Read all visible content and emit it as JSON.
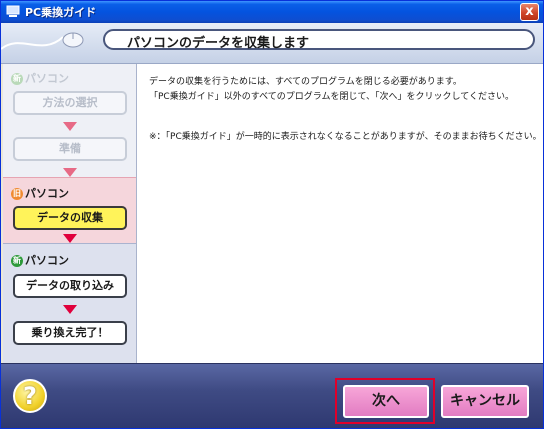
{
  "window": {
    "title": "PC乗換ガイド",
    "close_label": "x"
  },
  "header": {
    "title": "パソコンのデータを収集します"
  },
  "sidebar": {
    "pc_section": {
      "label": "パソコン",
      "badge": "新"
    },
    "old_section": {
      "label": "パソコン",
      "badge": "旧"
    },
    "new_section": {
      "label": "パソコン",
      "badge": "新"
    },
    "steps": [
      {
        "label": "方法の選択",
        "state": "disabled"
      },
      {
        "label": "準備",
        "state": "disabled"
      },
      {
        "label": "データの収集",
        "state": "active"
      },
      {
        "label": "データの取り込み",
        "state": "normal"
      },
      {
        "label": "乗り換え完了！",
        "state": "normal"
      }
    ]
  },
  "content": {
    "line1": "データの収集を行うためには、すべてのプログラムを閉じる必要があります。",
    "line2": "「PC乗換ガイド」以外のすべてのプログラムを閉じて、「次へ」をクリックしてください。",
    "note": "※：「PC乗換ガイド」が一時的に表示されなくなることがありますが、そのままお待ちください。"
  },
  "footer": {
    "help_label": "?",
    "next_label": "次へ",
    "cancel_label": "キャンセル"
  },
  "colors": {
    "accent_pink": "#e27cc2",
    "active_step": "#fff35a",
    "arrow": "#e0003c",
    "titlebar": "#0453df"
  }
}
